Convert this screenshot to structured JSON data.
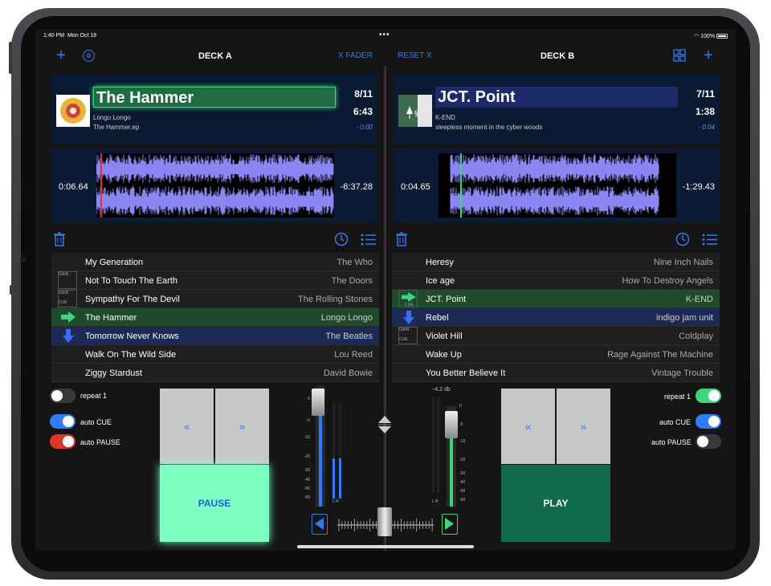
{
  "status": {
    "time": "1:40 PM",
    "date": "Mon Oct 18",
    "dots": "•••",
    "battery": "100%"
  },
  "nav": {
    "deck_a": "DECK A",
    "deck_b": "DECK B",
    "xfader": "X FADER",
    "reset_x": "RESET X"
  },
  "deckA": {
    "title": "The Hammer",
    "artist": "Longo Longo",
    "album": "The Hammer.ep",
    "track_pos": "8/11",
    "duration": "6:43",
    "remaining_small": "- 0:00",
    "elapsed": "0:06.64",
    "remaining": "-6:37.28",
    "progress": 0.02
  },
  "deckB": {
    "title": "JCT. Point",
    "artist": "K-END",
    "album": "sleepless moment in the cyber woods",
    "track_pos": "7/11",
    "duration": "1:38",
    "remaining_small": "- 0:04",
    "elapsed": "0:04.65",
    "remaining": "-1:29.43",
    "progress": 0.05
  },
  "gain": "GAIN",
  "cue": "CUE",
  "listA": [
    {
      "title": "My Generation",
      "artist": "The Who"
    },
    {
      "title": "Not To Touch The Earth",
      "artist": "The Doors"
    },
    {
      "title": "Sympathy For The Devil",
      "artist": "The Rolling Stones"
    },
    {
      "title": "The Hammer",
      "artist": "Longo Longo"
    },
    {
      "title": "Tomorrow Never Knows",
      "artist": "The Beatles"
    },
    {
      "title": "Walk On The Wild Side",
      "artist": "Lou Reed"
    },
    {
      "title": "Ziggy Stardust",
      "artist": "David Bowie"
    }
  ],
  "listB": [
    {
      "title": "Heresy",
      "artist": "Nine Inch Nails"
    },
    {
      "title": "Ice age",
      "artist": "How To Destroy Angels"
    },
    {
      "title": "JCT. Point",
      "artist": "K-END"
    },
    {
      "title": "Rebel",
      "artist": "indigo jam unit"
    },
    {
      "title": "Violet Hill",
      "artist": "Coldplay"
    },
    {
      "title": "Wake Up",
      "artist": "Rage Against The Machine"
    },
    {
      "title": "You Better Believe It",
      "artist": "Vintage Trouble"
    }
  ],
  "controlsA": {
    "repeat": "repeat 1",
    "auto_cue": "auto CUE",
    "auto_pause": "auto PAUSE",
    "rew": "«",
    "ff": "»",
    "main": "PAUSE"
  },
  "controlsB": {
    "repeat": "repeat 1",
    "auto_cue": "auto CUE",
    "auto_pause": "auto PAUSE",
    "rew": "«",
    "ff": "»",
    "main": "PLAY"
  },
  "mixer": {
    "db_readout": "-4.2 db",
    "scale": [
      "0",
      "-5",
      "-10",
      "-20",
      "-30",
      "-40",
      "-50",
      "-60"
    ],
    "L": "L",
    "R": "R"
  },
  "colors": {
    "accent": "#2f7cf6",
    "green_row": "#1f4a2c",
    "blue_row": "#1c2a55",
    "pause_bg": "#7dffc0",
    "play_bg": "#0f6b4c"
  }
}
